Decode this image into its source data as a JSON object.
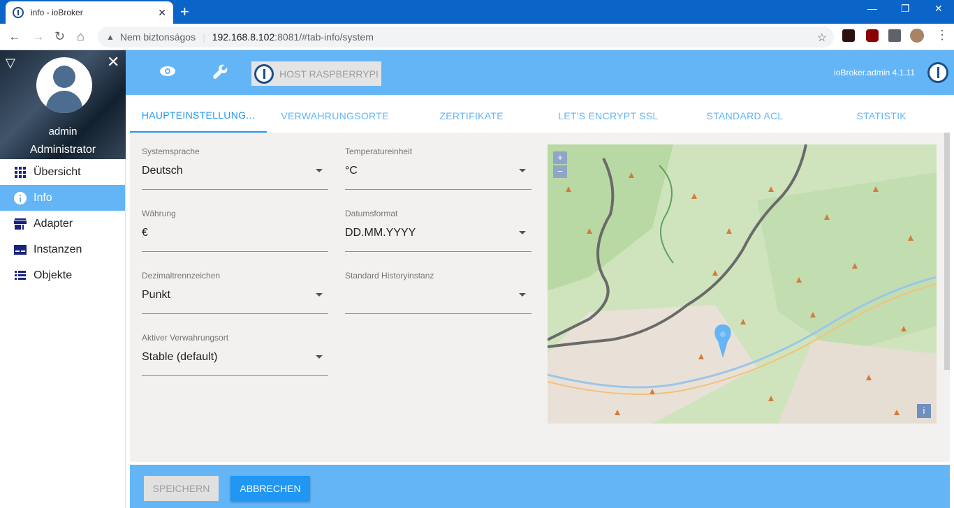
{
  "browser": {
    "tab_title": "info - ioBroker",
    "new_tab_symbol": "+",
    "address_security": "Nem biztonságos",
    "address_host": "192.168.8.102",
    "address_path": ":8081/#tab-info/system"
  },
  "sidebar": {
    "user": "admin",
    "role": "Administrator",
    "items": [
      {
        "label": "Übersicht",
        "icon": "grid-icon"
      },
      {
        "label": "Info",
        "icon": "info-icon",
        "active": true
      },
      {
        "label": "Adapter",
        "icon": "store-icon"
      },
      {
        "label": "Instanzen",
        "icon": "instances-icon"
      },
      {
        "label": "Objekte",
        "icon": "list-icon"
      }
    ]
  },
  "appbar": {
    "host_label": "HOST RASPBERRYPI",
    "version": "ioBroker.admin 4.1.11"
  },
  "tabs": [
    {
      "label": "HAUPTEINSTELLUNG...",
      "active": true
    },
    {
      "label": "VERWAHRUNGSORTE"
    },
    {
      "label": "ZERTIFIKATE"
    },
    {
      "label": "LET'S ENCRYPT SSL"
    },
    {
      "label": "STANDARD ACL"
    },
    {
      "label": "STATISTIK"
    }
  ],
  "form": {
    "system_language": {
      "label": "Systemsprache",
      "value": "Deutsch"
    },
    "temperature_unit": {
      "label": "Temperatureinheit",
      "value": "°C"
    },
    "currency": {
      "label": "Währung",
      "value": "€"
    },
    "date_format": {
      "label": "Datumsformat",
      "value": "DD.MM.YYYY"
    },
    "decimal_separator": {
      "label": "Dezimaltrennzeichen",
      "value": "Punkt"
    },
    "default_history": {
      "label": "Standard Historyinstanz",
      "value": ""
    },
    "active_repository": {
      "label": "Aktiver Verwahrungsort",
      "value": "Stable (default)"
    }
  },
  "map": {
    "zoom_in": "+",
    "zoom_out": "−",
    "info_symbol": "i"
  },
  "footer": {
    "save_label": "SPEICHERN",
    "cancel_label": "ABBRECHEN"
  },
  "colors": {
    "accent": "#64b5f6",
    "primary": "#2196f3"
  }
}
